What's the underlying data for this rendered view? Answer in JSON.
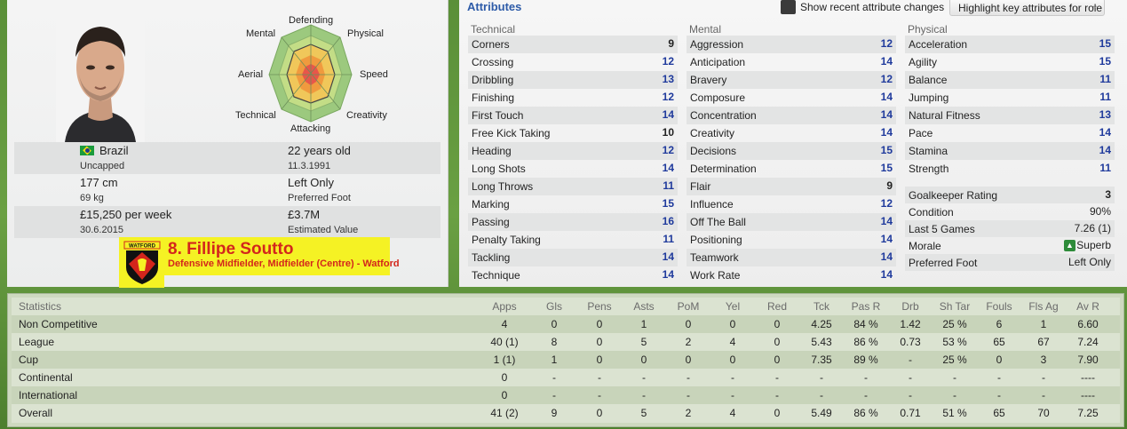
{
  "profile": {
    "radar_labels": {
      "defending": "Defending",
      "physical": "Physical",
      "speed": "Speed",
      "creativity": "Creativity",
      "attacking": "Attacking",
      "technical": "Technical",
      "aerial": "Aerial",
      "mental": "Mental"
    },
    "nationality": "Brazil",
    "caps": "Uncapped",
    "age": "22 years old",
    "dob": "11.3.1991",
    "height": "177 cm",
    "weight": "69 kg",
    "foot": "Left Only",
    "foot_label": "Preferred Foot",
    "wage": "£15,250 per week",
    "contract_end": "30.6.2015",
    "value": "£3.7M",
    "value_label": "Estimated Value",
    "name": "8. Fillipe Soutto",
    "role": "Defensive Midfielder, Midfielder (Centre) - Watford",
    "club_badge_text": "WATFORD"
  },
  "attributes": {
    "title": "Attributes",
    "recent_changes_label": "Show recent attribute changes",
    "highlight_label": "Highlight key attributes for role",
    "technical": {
      "title": "Technical",
      "items": [
        {
          "name": "Corners",
          "value": "9"
        },
        {
          "name": "Crossing",
          "value": "12"
        },
        {
          "name": "Dribbling",
          "value": "13"
        },
        {
          "name": "Finishing",
          "value": "12"
        },
        {
          "name": "First Touch",
          "value": "14"
        },
        {
          "name": "Free Kick Taking",
          "value": "10"
        },
        {
          "name": "Heading",
          "value": "12"
        },
        {
          "name": "Long Shots",
          "value": "14"
        },
        {
          "name": "Long Throws",
          "value": "11"
        },
        {
          "name": "Marking",
          "value": "15"
        },
        {
          "name": "Passing",
          "value": "16"
        },
        {
          "name": "Penalty Taking",
          "value": "11"
        },
        {
          "name": "Tackling",
          "value": "14"
        },
        {
          "name": "Technique",
          "value": "14"
        }
      ]
    },
    "mental": {
      "title": "Mental",
      "items": [
        {
          "name": "Aggression",
          "value": "12"
        },
        {
          "name": "Anticipation",
          "value": "14"
        },
        {
          "name": "Bravery",
          "value": "12"
        },
        {
          "name": "Composure",
          "value": "14"
        },
        {
          "name": "Concentration",
          "value": "14"
        },
        {
          "name": "Creativity",
          "value": "14"
        },
        {
          "name": "Decisions",
          "value": "15"
        },
        {
          "name": "Determination",
          "value": "15"
        },
        {
          "name": "Flair",
          "value": "9"
        },
        {
          "name": "Influence",
          "value": "12"
        },
        {
          "name": "Off The Ball",
          "value": "14"
        },
        {
          "name": "Positioning",
          "value": "14"
        },
        {
          "name": "Teamwork",
          "value": "14"
        },
        {
          "name": "Work Rate",
          "value": "14"
        }
      ]
    },
    "physical": {
      "title": "Physical",
      "items": [
        {
          "name": "Acceleration",
          "value": "15"
        },
        {
          "name": "Agility",
          "value": "15"
        },
        {
          "name": "Balance",
          "value": "11"
        },
        {
          "name": "Jumping",
          "value": "11"
        },
        {
          "name": "Natural Fitness",
          "value": "13"
        },
        {
          "name": "Pace",
          "value": "14"
        },
        {
          "name": "Stamina",
          "value": "14"
        },
        {
          "name": "Strength",
          "value": "11"
        }
      ],
      "extra": [
        {
          "name": "Goalkeeper Rating",
          "value": "3"
        },
        {
          "name": "Condition",
          "value": "90%"
        },
        {
          "name": "Last 5 Games",
          "value": "7.26 (1)"
        },
        {
          "name": "Morale",
          "value": "Superb"
        },
        {
          "name": "Preferred Foot",
          "value": "Left Only"
        }
      ]
    }
  },
  "statistics": {
    "title": "Statistics",
    "headers": [
      "Apps",
      "Gls",
      "Pens",
      "Asts",
      "PoM",
      "Yel",
      "Red",
      "Tck",
      "Pas R",
      "Drb",
      "Sh Tar",
      "Fouls",
      "Fls Ag",
      "Av R"
    ],
    "rows": [
      {
        "label": "Non Competitive",
        "cells": [
          "4",
          "0",
          "0",
          "1",
          "0",
          "0",
          "0",
          "4.25",
          "84 %",
          "1.42",
          "25 %",
          "6",
          "1",
          "6.60"
        ]
      },
      {
        "label": "League",
        "cells": [
          "40 (1)",
          "8",
          "0",
          "5",
          "2",
          "4",
          "0",
          "5.43",
          "86 %",
          "0.73",
          "53 %",
          "65",
          "67",
          "7.24"
        ]
      },
      {
        "label": "Cup",
        "cells": [
          "1 (1)",
          "1",
          "0",
          "0",
          "0",
          "0",
          "0",
          "7.35",
          "89 %",
          "-",
          "25 %",
          "0",
          "3",
          "7.90"
        ]
      },
      {
        "label": "Continental",
        "cells": [
          "0",
          "-",
          "-",
          "-",
          "-",
          "-",
          "-",
          "-",
          "-",
          "-",
          "-",
          "-",
          "-",
          "----"
        ]
      },
      {
        "label": "International",
        "cells": [
          "0",
          "-",
          "-",
          "-",
          "-",
          "-",
          "-",
          "-",
          "-",
          "-",
          "-",
          "-",
          "-",
          "----"
        ]
      },
      {
        "label": "Overall",
        "cells": [
          "41 (2)",
          "9",
          "0",
          "5",
          "2",
          "4",
          "0",
          "5.49",
          "86 %",
          "0.71",
          "51 %",
          "65",
          "70",
          "7.25"
        ]
      }
    ]
  },
  "colors": {
    "highlight_value": "#1f3a9c",
    "name_banner": "#f5f224",
    "name_text": "#d3261c",
    "title_blue": "#2d5ba8"
  }
}
